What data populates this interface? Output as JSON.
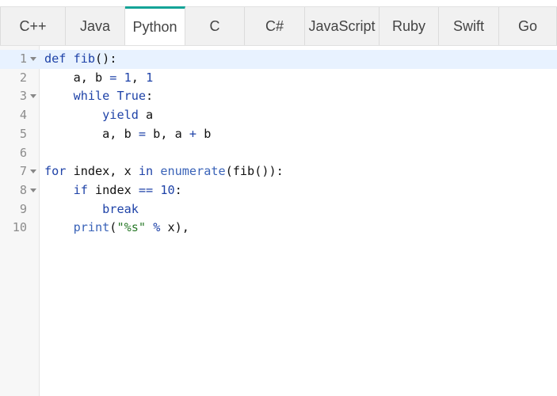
{
  "tabs": [
    {
      "label": "C++",
      "active": false
    },
    {
      "label": "Java",
      "active": false
    },
    {
      "label": "Python",
      "active": true
    },
    {
      "label": "C",
      "active": false
    },
    {
      "label": "C#",
      "active": false
    },
    {
      "label": "JavaScript",
      "active": false
    },
    {
      "label": "Ruby",
      "active": false
    },
    {
      "label": "Swift",
      "active": false
    },
    {
      "label": "Go",
      "active": false
    }
  ],
  "accent_color": "#14a397",
  "editor": {
    "active_line": 1,
    "lines": [
      {
        "number": "1",
        "foldable": true,
        "tokens": [
          [
            "k",
            "def"
          ],
          [
            "p",
            " "
          ],
          [
            "n",
            "fib"
          ],
          [
            "p",
            "():"
          ]
        ]
      },
      {
        "number": "2",
        "foldable": false,
        "tokens": [
          [
            "p",
            "    a, b "
          ],
          [
            "o",
            "="
          ],
          [
            "p",
            " "
          ],
          [
            "n",
            "1"
          ],
          [
            "p",
            ", "
          ],
          [
            "n",
            "1"
          ]
        ]
      },
      {
        "number": "3",
        "foldable": true,
        "tokens": [
          [
            "p",
            "    "
          ],
          [
            "k",
            "while"
          ],
          [
            "p",
            " "
          ],
          [
            "k",
            "True"
          ],
          [
            "p",
            ":"
          ]
        ]
      },
      {
        "number": "4",
        "foldable": false,
        "tokens": [
          [
            "p",
            "        "
          ],
          [
            "k",
            "yield"
          ],
          [
            "p",
            " a"
          ]
        ]
      },
      {
        "number": "5",
        "foldable": false,
        "tokens": [
          [
            "p",
            "        a, b "
          ],
          [
            "o",
            "="
          ],
          [
            "p",
            " b, a "
          ],
          [
            "o",
            "+"
          ],
          [
            "p",
            " b"
          ]
        ]
      },
      {
        "number": "6",
        "foldable": false,
        "tokens": []
      },
      {
        "number": "7",
        "foldable": true,
        "tokens": [
          [
            "k",
            "for"
          ],
          [
            "p",
            " index, x "
          ],
          [
            "k",
            "in"
          ],
          [
            "p",
            " "
          ],
          [
            "b",
            "enumerate"
          ],
          [
            "p",
            "(fib()):"
          ]
        ]
      },
      {
        "number": "8",
        "foldable": true,
        "tokens": [
          [
            "p",
            "    "
          ],
          [
            "k",
            "if"
          ],
          [
            "p",
            " index "
          ],
          [
            "o",
            "=="
          ],
          [
            "p",
            " "
          ],
          [
            "n",
            "10"
          ],
          [
            "p",
            ":"
          ]
        ]
      },
      {
        "number": "9",
        "foldable": false,
        "tokens": [
          [
            "p",
            "        "
          ],
          [
            "k",
            "break"
          ]
        ]
      },
      {
        "number": "10",
        "foldable": false,
        "tokens": [
          [
            "p",
            "    "
          ],
          [
            "b",
            "print"
          ],
          [
            "p",
            "("
          ],
          [
            "s",
            "\"%s\""
          ],
          [
            "p",
            " "
          ],
          [
            "o",
            "%"
          ],
          [
            "p",
            " x),"
          ]
        ]
      }
    ]
  }
}
